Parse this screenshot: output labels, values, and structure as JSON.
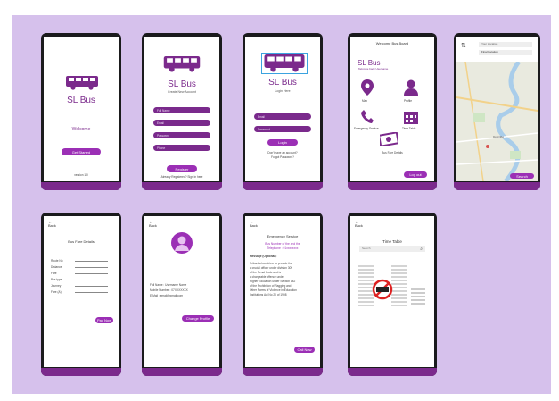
{
  "app": {
    "name": "SL Bus"
  },
  "colors": {
    "background": "#d6c1ec",
    "primary": "#7b2a8c",
    "accent": "#9b2fb5",
    "phone": "#1b1b1d"
  },
  "screens": {
    "welcome": {
      "title": "SL Bus",
      "welcome": "Welcome",
      "button": "Get Started",
      "footer": "version 1.0"
    },
    "register": {
      "title": "SL Bus",
      "subtitle": "Create New Account",
      "fields": [
        "Full Name",
        "Email",
        "Password",
        "Phone"
      ],
      "button": "Register",
      "footer": "Already Registered? Sign in here"
    },
    "login": {
      "title": "SL Bus",
      "subtitle": "Login Here",
      "fields": [
        "Email",
        "Password"
      ],
      "button": "Login",
      "footer_lines": [
        "Don't have an account?",
        "Forgot Password?"
      ]
    },
    "home": {
      "header": "Welcome Bus Board",
      "title": "SL Bus",
      "subtitle": "Welcome back Username",
      "items": [
        "Map",
        "Profile",
        "Emergency Service",
        "Time Table",
        "Bus Fare Details"
      ],
      "button": "Log out"
    },
    "map": {
      "from_placeholder": "Your Location",
      "to_placeholder": "Final Location",
      "route_label": "Colombo",
      "button": "Search"
    },
    "fare": {
      "back": "Back",
      "title": "Bus Fare Details",
      "labels": [
        "Route No",
        "Distance",
        "Fare",
        "Bus type",
        "Journey",
        "Fare (A)"
      ],
      "button": "Pay Now"
    },
    "profile": {
      "back": "Back",
      "lines": [
        "Full Name : Username Name",
        "Mobile Number : 07XXXXXXX",
        "E-Mail : email@gmail.com"
      ],
      "button": "Change Profile"
    },
    "emergency": {
      "back": "Back",
      "title": "Emergency Service",
      "heading": [
        "Bus Number of the and the",
        "Telephone : 01xxxxxxxx"
      ],
      "message_label": "Message (Optional):",
      "message": [
        "SriLanka bus driver to provide the",
        "a crucial officer under division 309",
        "of the Penal Code and is",
        "a chargeable offence under",
        "Higher Education under Section 182",
        "of the Prohibition of Ragging and",
        "Other Forms of Violence in Education",
        "Institutions Act No 20 of 1998"
      ],
      "button": "Call Now"
    },
    "timetable": {
      "back": "Back",
      "title": "Time Table",
      "search_placeholder": "Search"
    }
  }
}
